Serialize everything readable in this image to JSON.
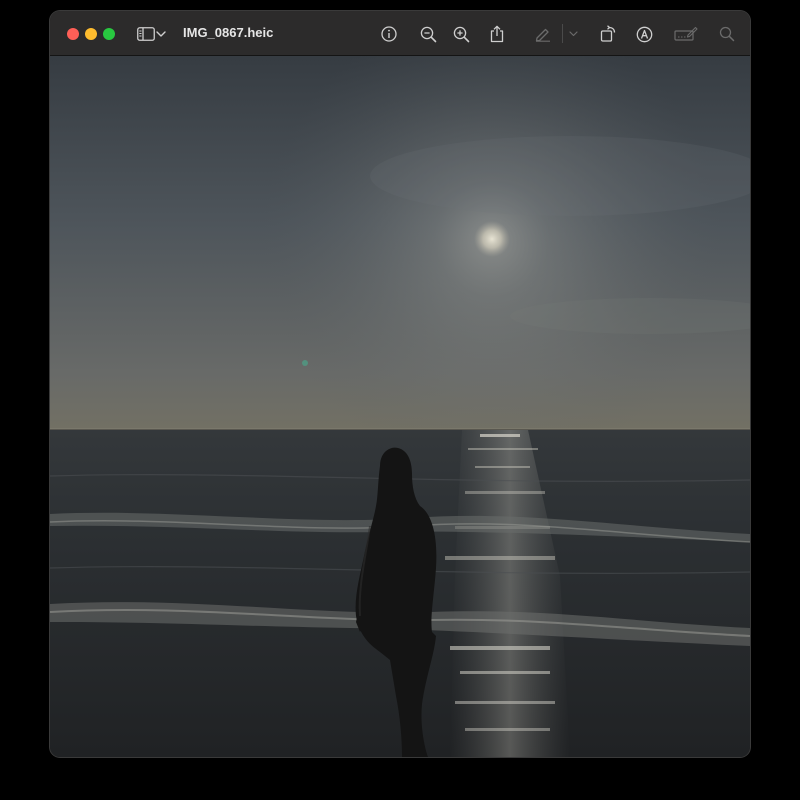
{
  "window": {
    "title": "IMG_0867.heic"
  },
  "traffic_lights": {
    "close_color": "#ff5f57",
    "minimize_color": "#febc2e",
    "zoom_color": "#28c840"
  },
  "toolbar": {
    "icons": [
      "sidebar-icon",
      "chevron-down-icon",
      "info-icon",
      "zoom-out-icon",
      "zoom-in-icon",
      "share-icon",
      "highlight-pen-icon",
      "chevron-down-icon",
      "rotate-icon",
      "markup-icon",
      "form-fill-icon",
      "search-icon"
    ]
  },
  "image": {
    "description_name": "photo-beach-silhouette-sunset"
  }
}
